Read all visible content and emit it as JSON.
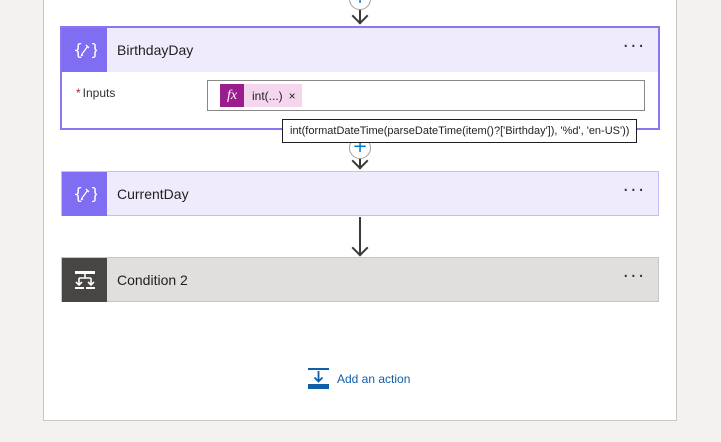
{
  "steps": [
    {
      "title": "BirthdayDay",
      "icon": "variable-icon"
    },
    {
      "title": "CurrentDay",
      "icon": "variable-icon"
    },
    {
      "title": "Condition 2",
      "icon": "condition-icon"
    }
  ],
  "birthday": {
    "inputs_label": "Inputs",
    "required_mark": "*",
    "token_label": "int(...)",
    "token_close": "×",
    "fx_label": "fx",
    "tooltip": "int(formatDateTime(parseDateTime(item()?['Birthday']), '%d', 'en-US'))"
  },
  "more_label": "···",
  "insert_label": "+",
  "add_action": {
    "label": "Add an action"
  },
  "colors": {
    "variable": "#7f6df2",
    "condition": "#484644",
    "link": "#0f5ea8",
    "token": "#9b1c8e"
  }
}
